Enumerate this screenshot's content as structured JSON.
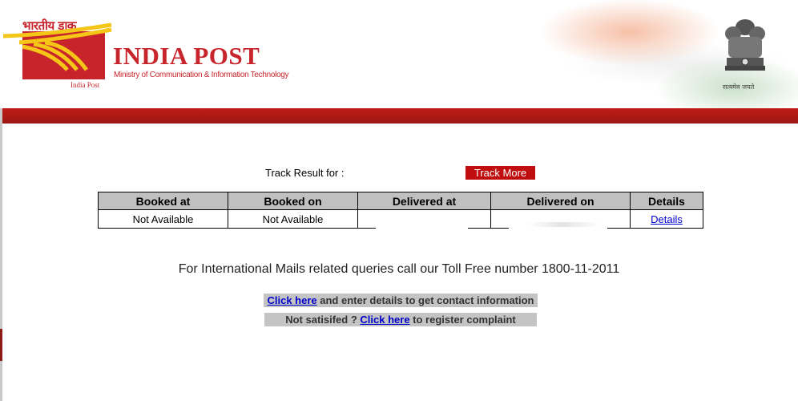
{
  "header": {
    "hindi_logo": "भारतीय डाक",
    "brand_name": "INDIA POST",
    "ministry": "Ministry of Communication & Information Technology",
    "logo_caption": "India Post",
    "motto": "सत्यमेव जयते"
  },
  "track": {
    "label": "Track Result for :",
    "button_label": "Track More"
  },
  "table": {
    "headers": [
      "Booked at",
      "Booked on",
      "Delivered at",
      "Delivered on",
      "Details"
    ],
    "rows": [
      {
        "booked_at": "Not Available",
        "booked_on": "Not Available",
        "delivered_at": "",
        "delivered_on": "",
        "details": "Details"
      }
    ]
  },
  "info": {
    "tollfree": "For International Mails related queries call our Toll Free number 1800-11-2011",
    "contact_link": "Click here",
    "contact_text": " and enter details to get contact information",
    "complaint_prefix": "Not satisifed ? ",
    "complaint_link": "Click here",
    "complaint_suffix": " to register complaint"
  },
  "colors": {
    "brand_red": "#c8242b",
    "band_red": "#b01a15",
    "button_red": "#c00d0d",
    "header_gray": "#c0c0c0",
    "link_blue": "#0000cc"
  },
  "icons": [
    "india-post-logo-icon",
    "national-emblem-icon"
  ]
}
